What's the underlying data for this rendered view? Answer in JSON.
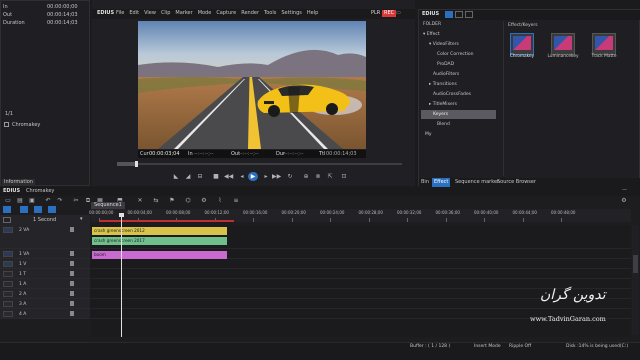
{
  "app": {
    "name": "EDIUS",
    "menu": [
      "File",
      "Edit",
      "View",
      "Clip",
      "Marker",
      "Mode",
      "Capture",
      "Render",
      "Tools",
      "Settings",
      "Help"
    ],
    "mode_plr": "PLR",
    "mode_rec": "REC"
  },
  "info_panel": {
    "fields": [
      {
        "label": "In",
        "value": "00:00:00;00"
      },
      {
        "label": "Out",
        "value": "00:00:14;03"
      },
      {
        "label": "Duration",
        "value": "00:00:14;03"
      }
    ],
    "track_label": "1/1",
    "effect_name": "Chromakey",
    "tab": "Information"
  },
  "player": {
    "cur_label": "Cur",
    "cur": "00:00:03;04",
    "in_label": "In",
    "in": "--:--:--;--",
    "out_label": "Out",
    "out": "--:--:--;--",
    "dur_label": "Dur",
    "dur": "--:--:--;--",
    "ttl_label": "Ttl",
    "ttl": "00:00:14;03"
  },
  "effect_panel": {
    "header_name": "EDIUS",
    "folder_label": "FOLDER",
    "tree": [
      {
        "label": "Effect",
        "indent": 0,
        "icon": "▾"
      },
      {
        "label": "VideoFilters",
        "indent": 1,
        "icon": "▾"
      },
      {
        "label": "Color Correction",
        "indent": 2,
        "icon": ""
      },
      {
        "label": "ProDAD",
        "indent": 2,
        "icon": ""
      },
      {
        "label": "AudioFilters",
        "indent": 1,
        "icon": ""
      },
      {
        "label": "Transitions",
        "indent": 1,
        "icon": "▸"
      },
      {
        "label": "AudioCrossFades",
        "indent": 1,
        "icon": ""
      },
      {
        "label": "TitleMixers",
        "indent": 1,
        "icon": "▸"
      },
      {
        "label": "Keyers",
        "indent": 1,
        "icon": "",
        "selected": true
      },
      {
        "label": "Blend",
        "indent": 2,
        "icon": ""
      },
      {
        "label": "My",
        "indent": 0,
        "icon": ""
      }
    ],
    "breadcrumb": "Effect/Keyers",
    "effects": [
      "Chromakey",
      "Luminancekey",
      "Track Matte"
    ],
    "tabs": [
      "Bin",
      "Effect",
      "Sequence marker",
      "Source Browser"
    ]
  },
  "timeline": {
    "app_name": "EDIUS",
    "project_name": "Chromakey",
    "sequence_tab": "Sequence1",
    "scale_label": "1 Second",
    "ruler": [
      "00:00:00;00",
      "00:00:04;00",
      "00:00:08;00",
      "00:00:12;00",
      "00:00:16;00",
      "00:00:20;00",
      "00:00:24;00",
      "00:00:28;00",
      "00:00:32;00",
      "00:00:36;00",
      "00:00:40;00",
      "00:00:44;00",
      "00:00:48;00"
    ],
    "tracks": [
      {
        "name": "2 VA",
        "type": "va"
      },
      {
        "name": "1 VA",
        "type": "va"
      },
      {
        "name": "1 V",
        "type": "v"
      },
      {
        "name": "1 T",
        "type": "t"
      },
      {
        "name": "1 A",
        "type": "a"
      },
      {
        "name": "2 A",
        "type": "a"
      },
      {
        "name": "3 A",
        "type": "a"
      },
      {
        "name": "4 A",
        "type": "a"
      }
    ],
    "clips": [
      {
        "label": "crash greenscreen 2012",
        "color": "#d8c24a"
      },
      {
        "label": "crash greenscreen 2017",
        "color": "#6fbf8c"
      },
      {
        "label": "boom",
        "color": "#c86ad0"
      }
    ]
  },
  "status_bar": {
    "buffer": "Buffer : ( 1 / 128 )",
    "insert_mode": "Insert Mode",
    "ripple": "Ripple Off",
    "disk": "Disk :14% is being used(C:)"
  },
  "watermark": {
    "title": "تدوین گران",
    "url": "www.TadvinGaran.com"
  },
  "colors": {
    "accent": "#2b6fbf",
    "rec": "#d83a3a",
    "selection": "#2e5f95"
  }
}
